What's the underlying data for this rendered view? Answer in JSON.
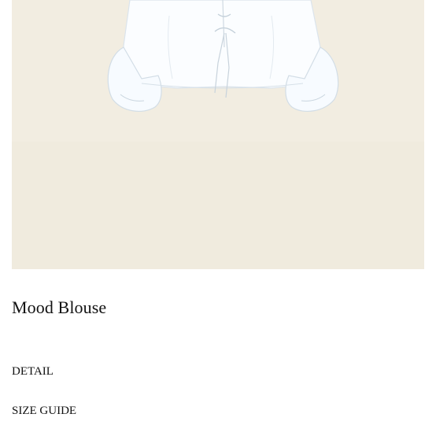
{
  "product": {
    "title": "Mood Blouse",
    "image_alt": "white blouse with tie front",
    "image_background": "#f2ede1"
  },
  "sections": {
    "detail_label": "DETAIL",
    "size_guide_label": "SIZE GUIDE"
  }
}
